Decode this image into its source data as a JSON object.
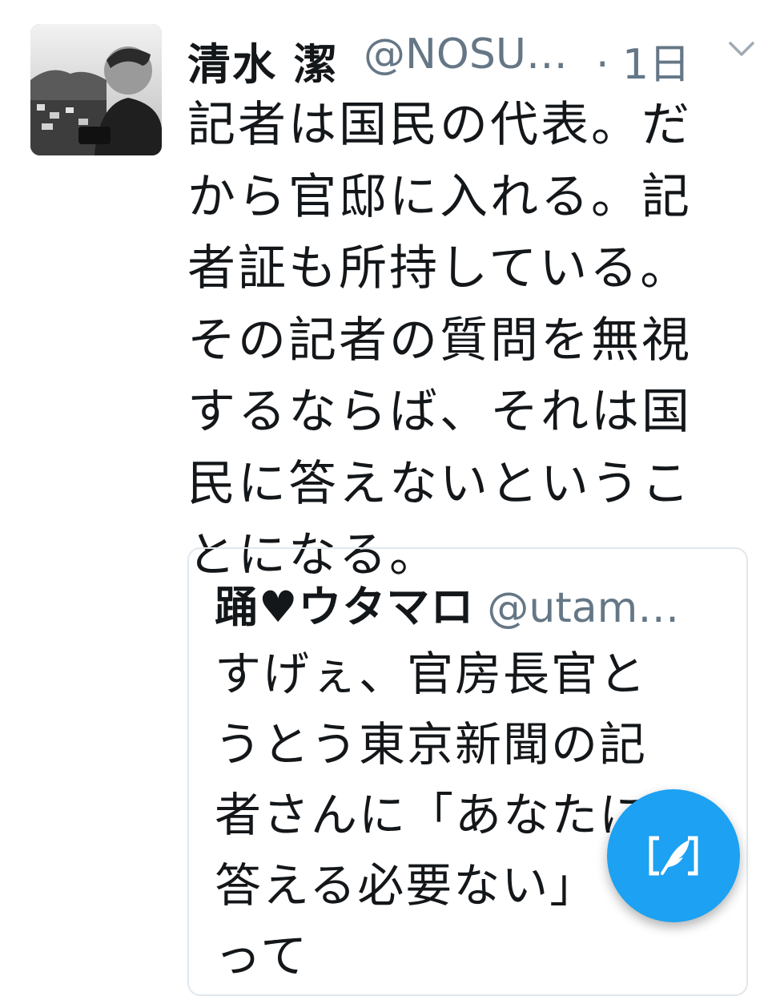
{
  "tweet": {
    "author_name": "清水 潔",
    "author_handle": "@NOSU…",
    "time": "· 1日",
    "text_lines": [
      "記者は国民の代表。だ",
      "から官邸に入れる。記",
      "者証も所持している。",
      "その記者の質問を無視",
      "するならば、それは国",
      "民に答えないというこ",
      "とになる。"
    ]
  },
  "quoted_tweet": {
    "author_name": "踊♥ウタマロ",
    "author_handle": "@utam…",
    "text_lines": [
      "すげぇ、官房長官と",
      "うとう東京新聞の記",
      "者さんに「あなたに",
      "答える必要ない」",
      "って"
    ]
  },
  "icons": {
    "caret": "chevron-down-icon",
    "compose": "compose-tweet-icon"
  },
  "colors": {
    "accent": "#1da1f2",
    "secondary_text": "#657786",
    "border": "#e1e8ed"
  }
}
